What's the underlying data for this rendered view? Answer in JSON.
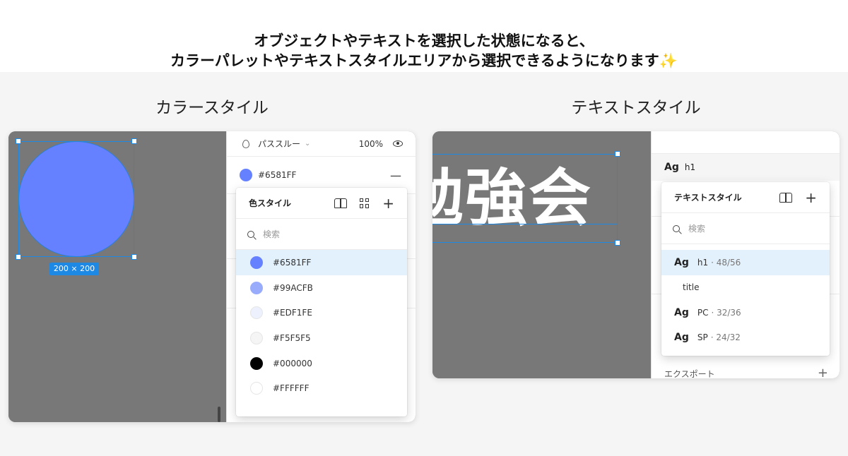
{
  "headline": {
    "line1": "オブジェクトやテキストを選択した状態になると、",
    "line2": "カラーパレットやテキストスタイルエリアから選択できるようになります",
    "sparkle": "✨"
  },
  "sections": {
    "color_title": "カラースタイル",
    "text_title": "テキストスタイル"
  },
  "color_panel": {
    "size_badge": "200 × 200",
    "layer_blend": "パススルー",
    "opacity": "100%",
    "fill_hex": "#6581FF",
    "fill_color": "#6581FF",
    "popover": {
      "title": "色スタイル",
      "search_placeholder": "検索",
      "items": [
        {
          "label": "#6581FF",
          "color": "#6581FF",
          "active": true
        },
        {
          "label": "#99ACFB",
          "color": "#99ACFB",
          "active": false
        },
        {
          "label": "#EDF1FE",
          "color": "#EDF1FE",
          "active": false
        },
        {
          "label": "#F5F5F5",
          "color": "#F5F5F5",
          "active": false
        },
        {
          "label": "#000000",
          "color": "#000000",
          "active": false
        },
        {
          "label": "#FFFFFF",
          "color": "#FFFFFF",
          "active": false
        }
      ]
    }
  },
  "text_panel": {
    "canvas_text": "勉強会",
    "current_style_ag": "Ag",
    "current_style": "h1",
    "export_label": "エクスポート",
    "popover": {
      "title": "テキストスタイル",
      "search_placeholder": "検索",
      "items": [
        {
          "ag": "Ag",
          "name": "h1",
          "meta": "· 48/56",
          "active": true
        },
        {
          "ag": "",
          "name": "title",
          "meta": "",
          "active": false
        },
        {
          "ag": "Ag",
          "name": "PC",
          "meta": "· 32/36",
          "active": false
        },
        {
          "ag": "Ag",
          "name": "SP",
          "meta": "· 24/32",
          "active": false
        }
      ]
    }
  }
}
